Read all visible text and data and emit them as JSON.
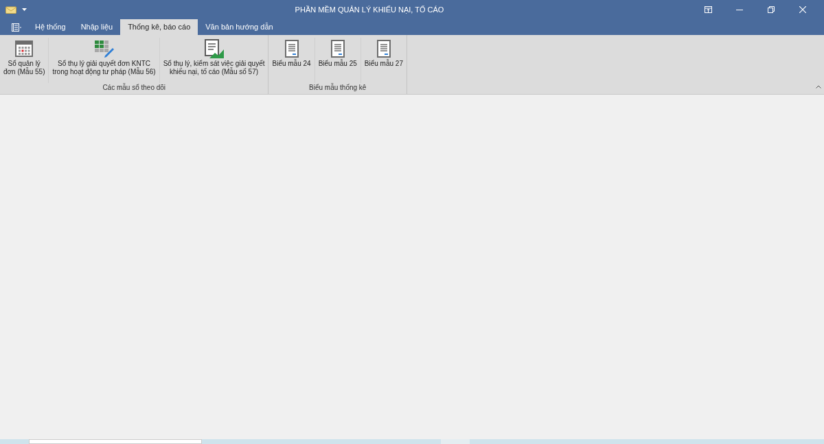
{
  "window": {
    "title": "PHẦN MỀM QUẢN LÝ KHIẾU NẠI, TỐ CÁO"
  },
  "tabs": [
    {
      "label": "Hệ thống",
      "selected": false
    },
    {
      "label": "Nhập liệu",
      "selected": false
    },
    {
      "label": "Thống kê, báo cáo",
      "selected": true
    },
    {
      "label": "Văn bản hướng dẫn",
      "selected": false
    }
  ],
  "ribbon_groups": [
    {
      "label": "Các mẫu sổ theo dõi",
      "buttons": [
        {
          "kind": "calendar",
          "lines": [
            "Sổ quản lý",
            "đơn (Mẫu 55)"
          ]
        },
        {
          "kind": "grid-edit",
          "lines": [
            "Sổ thụ lý giải quyết đơn KNTC",
            "trong hoạt động tư pháp (Mẫu 56)"
          ]
        },
        {
          "kind": "doc-chart",
          "lines": [
            "Sổ thụ lý, kiểm sát việc giải quyết",
            "khiếu nại, tố cáo (Mẫu số 57)"
          ]
        }
      ]
    },
    {
      "label": "Biểu mẫu thống kê",
      "buttons": [
        {
          "kind": "doc",
          "lines": [
            "Biểu mẫu 24"
          ]
        },
        {
          "kind": "doc",
          "lines": [
            "Biểu mẫu 25"
          ]
        },
        {
          "kind": "doc",
          "lines": [
            "Biểu mẫu 27"
          ]
        }
      ]
    }
  ]
}
